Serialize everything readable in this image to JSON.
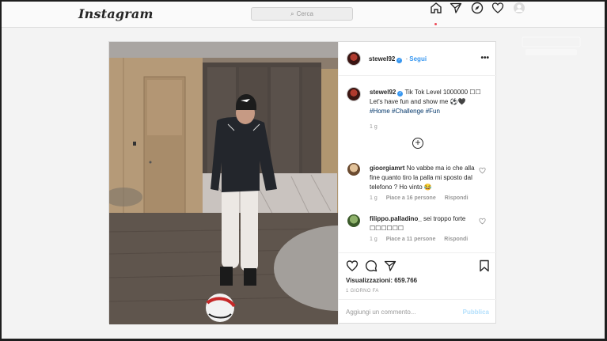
{
  "nav": {
    "logo": "Instagram",
    "search_placeholder": "Cerca",
    "icons": [
      "home-icon",
      "direct-icon",
      "explore-icon",
      "activity-heart-icon",
      "profile-icon"
    ]
  },
  "post": {
    "author": "stewel92",
    "follow_label": "Segui",
    "more_label": "•••",
    "caption": {
      "username": "stewel92",
      "text": "Tik Tok Level 1000000 ☐☐ Let's have fun and show me ⚽🖤",
      "hashtags": "#Home #Challenge #Fun",
      "time": "1 g"
    },
    "comments": [
      {
        "username": "gioorgiamrt",
        "text": "No vabbe ma io che alla fine quanto tiro la palla mi sposto dal telefono ? Ho vinto 😂",
        "time": "1 g",
        "likes": "Piace a 16 persone",
        "reply": "Rispondi"
      },
      {
        "username": "filippo.palladino_",
        "text": "sei troppo forte ☐☐☐☐☐☐",
        "time": "1 g",
        "likes": "Piace a 11 persone",
        "reply": "Rispondi"
      }
    ],
    "views": "Visualizzazioni: 659.766",
    "date": "1 GIORNO FA",
    "add_comment_placeholder": "Aggiungi un commento...",
    "publish_label": "Pubblica"
  },
  "colors": {
    "accent_blue": "#3897f0",
    "notification_red": "#ed4956"
  }
}
